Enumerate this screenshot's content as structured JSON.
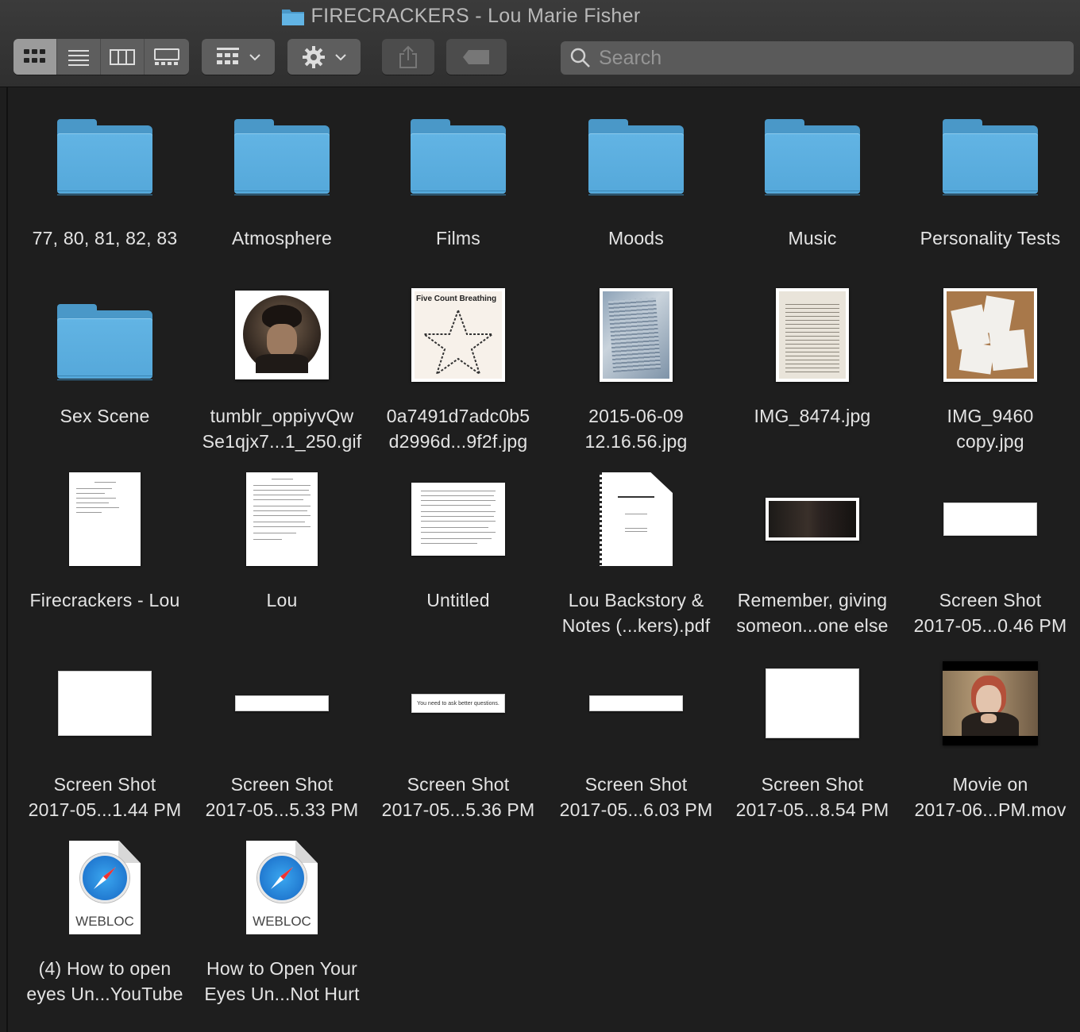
{
  "window": {
    "title": "FIRECRACKERS - Lou Marie Fisher"
  },
  "toolbar": {
    "view_modes": [
      "icon-view",
      "list-view",
      "column-view",
      "gallery-view"
    ],
    "active_view": "icon-view",
    "search_placeholder": "Search"
  },
  "items": [
    {
      "kind": "folder",
      "label": "77, 80, 81, 82, 83"
    },
    {
      "kind": "folder",
      "label": "Atmosphere"
    },
    {
      "kind": "folder",
      "label": "Films"
    },
    {
      "kind": "folder",
      "label": "Moods"
    },
    {
      "kind": "folder",
      "label": "Music"
    },
    {
      "kind": "folder",
      "label": "Personality Tests"
    },
    {
      "kind": "folder",
      "label": "Sex Scene"
    },
    {
      "kind": "gif",
      "label": "tumblr_oppiyvQw\nSe1qjx7...1_250.gif"
    },
    {
      "kind": "image",
      "label": "0a7491d7adc0b5\nd2996d...9f2f.jpg",
      "caption": "Five Count Breathing"
    },
    {
      "kind": "image",
      "label": "2015-06-09\n12.16.56.jpg"
    },
    {
      "kind": "image",
      "label": "IMG_8474.jpg"
    },
    {
      "kind": "image",
      "label": "IMG_9460\ncopy.jpg"
    },
    {
      "kind": "document",
      "label": "Firecrackers - Lou"
    },
    {
      "kind": "document",
      "label": "Lou"
    },
    {
      "kind": "document",
      "label": "Untitled"
    },
    {
      "kind": "pdf",
      "label": "Lou Backstory &\nNotes (...kers).pdf"
    },
    {
      "kind": "screenshot",
      "label": "Remember, giving\nsomeon...one else"
    },
    {
      "kind": "screenshot",
      "label": "Screen Shot\n2017-05...0.46 PM"
    },
    {
      "kind": "screenshot",
      "label": "Screen Shot\n2017-05...1.44 PM"
    },
    {
      "kind": "screenshot",
      "label": "Screen Shot\n2017-05...5.33 PM"
    },
    {
      "kind": "screenshot",
      "label": "Screen Shot\n2017-05...5.36 PM",
      "caption": "You need to ask better questions."
    },
    {
      "kind": "screenshot",
      "label": "Screen Shot\n2017-05...6.03 PM"
    },
    {
      "kind": "screenshot",
      "label": "Screen Shot\n2017-05...8.54 PM"
    },
    {
      "kind": "movie",
      "label": "Movie on\n2017-06...PM.mov"
    },
    {
      "kind": "webloc",
      "label": "(4) How to open\neyes Un...YouTube",
      "badge": "WEBLOC"
    },
    {
      "kind": "webloc",
      "label": "How to Open Your\nEyes Un...Not Hurt",
      "badge": "WEBLOC"
    }
  ],
  "colors": {
    "folder": "#55a8da",
    "background": "#1e1e1e",
    "toolbar": "#353535"
  }
}
